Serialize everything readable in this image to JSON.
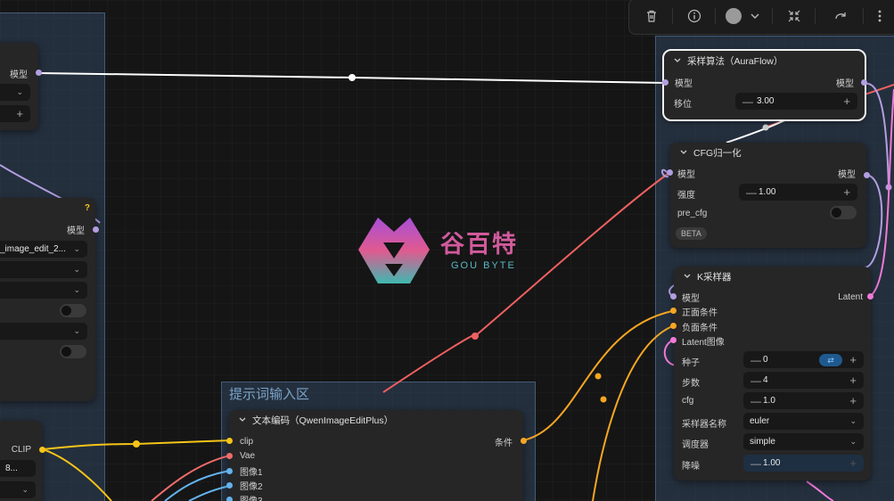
{
  "watermark": {
    "cn": "谷百特",
    "en": "GOU BYTE"
  },
  "group_prompt": {
    "title": "提示词输入区"
  },
  "left_nodes": {
    "node1": {
      "out_label": "模型"
    },
    "node2": {
      "out_label": "模型",
      "help": "?",
      "select_value": "_image_edit_2..."
    },
    "node3": {
      "out_label": "CLIP",
      "select_value": "8..."
    }
  },
  "node_auraflow": {
    "title": "采样算法（AuraFlow）",
    "in_label": "模型",
    "out_label": "模型",
    "shift_label": "移位",
    "shift_value": "3.00"
  },
  "node_cfgnorm": {
    "title": "CFG归一化",
    "in_label": "模型",
    "out_label": "模型",
    "strength_label": "强度",
    "strength_value": "1.00",
    "precfg_label": "pre_cfg",
    "badge": "BETA"
  },
  "node_ksampler": {
    "title": "K采样器",
    "inputs": [
      "模型",
      "正面条件",
      "负面条件",
      "Latent图像"
    ],
    "out_label": "Latent",
    "seed_label": "种子",
    "seed_value": "0",
    "steps_label": "步数",
    "steps_value": "4",
    "cfg_label": "cfg",
    "cfg_value": "1.0",
    "sampler_label": "采样器名称",
    "sampler_value": "euler",
    "scheduler_label": "调度器",
    "scheduler_value": "simple",
    "denoise_label": "降噪",
    "denoise_value": "1.00"
  },
  "node_textencode": {
    "title": "文本编码（QwenImageEditPlus）",
    "inputs": [
      "clip",
      "Vae",
      "图像1",
      "图像2",
      "图像3"
    ],
    "out_label": "条件"
  },
  "toolbar": {
    "icons": [
      "trash-icon",
      "info-icon",
      "color-circle-icon",
      "chevron-down-icon",
      "collapse-icon",
      "redo-icon",
      "more-icon"
    ]
  },
  "colors": {
    "model_wire": "#b29ee0",
    "clip_wire": "#f5c518",
    "cond_wire": "#f5a623",
    "latent_wire": "#f07ad8",
    "vae_wire": "#f06b6b",
    "image_wire": "#63b3ed",
    "red_wire": "#f06060",
    "white_wire": "#ffffff"
  }
}
